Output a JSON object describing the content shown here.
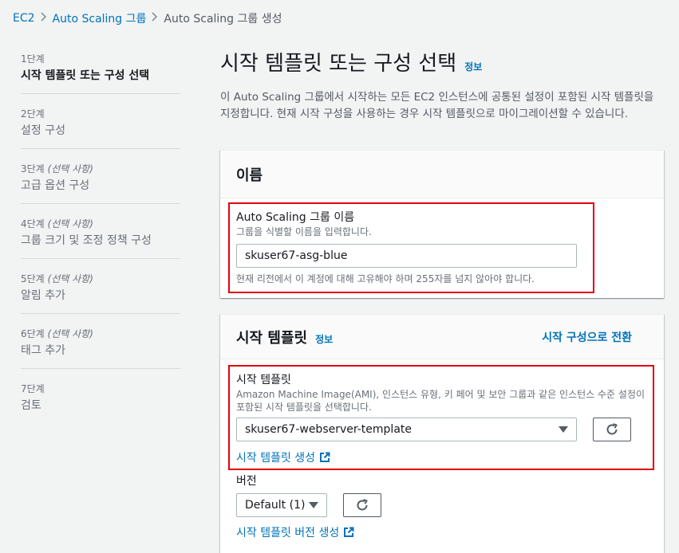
{
  "breadcrumb": {
    "items": [
      "EC2",
      "Auto Scaling 그룹"
    ],
    "current": "Auto Scaling 그룹 생성"
  },
  "steps": [
    {
      "num": "1단계",
      "optional": "",
      "title": "시작 템플릿 또는 구성 선택",
      "active": true
    },
    {
      "num": "2단계",
      "optional": "",
      "title": "설정 구성",
      "active": false
    },
    {
      "num": "3단계",
      "optional": "(선택 사항)",
      "title": "고급 옵션 구성",
      "active": false
    },
    {
      "num": "4단계",
      "optional": "(선택 사항)",
      "title": "그룹 크기 및 조정 정책 구성",
      "active": false
    },
    {
      "num": "5단계",
      "optional": "(선택 사항)",
      "title": "알림 추가",
      "active": false
    },
    {
      "num": "6단계",
      "optional": "(선택 사항)",
      "title": "태그 추가",
      "active": false
    },
    {
      "num": "7단계",
      "optional": "",
      "title": "검토",
      "active": false
    }
  ],
  "main": {
    "title": "시작 템플릿 또는 구성 선택",
    "info": "정보",
    "description": "이 Auto Scaling 그룹에서 시작하는 모든 EC2 인스턴스에 공통된 설정이 포함된 시작 템플릿을 지정합니다. 현재 시작 구성을 사용하는 경우 시작 템플릿으로 마이그레이션할 수 있습니다."
  },
  "name_panel": {
    "header": "이름",
    "label": "Auto Scaling 그룹 이름",
    "desc": "그룹을 식별할 이름을 입력합니다.",
    "value": "skuser67-asg-blue",
    "constraint": "현재 리전에서 이 계정에 대해 고유해야 하며 255자를 넘지 않아야 합니다."
  },
  "template_panel": {
    "header": "시작 템플릿",
    "info": "정보",
    "switch_link": "시작 구성으로 전환",
    "label": "시작 템플릿",
    "desc": "Amazon Machine Image(AMI), 인스턴스 유형, 키 페어 및 보안 그룹과 같은 인스턴스 수준 설정이 포함된 시작 템플릿을 선택합니다.",
    "selected": "skuser67-webserver-template",
    "create_link": "시작 템플릿 생성",
    "version_label": "버전",
    "version_selected": "Default (1)",
    "create_version_link": "시작 템플릿 버전 생성"
  },
  "colors": {
    "accent": "#0073bb",
    "highlight": "#e0000e"
  }
}
